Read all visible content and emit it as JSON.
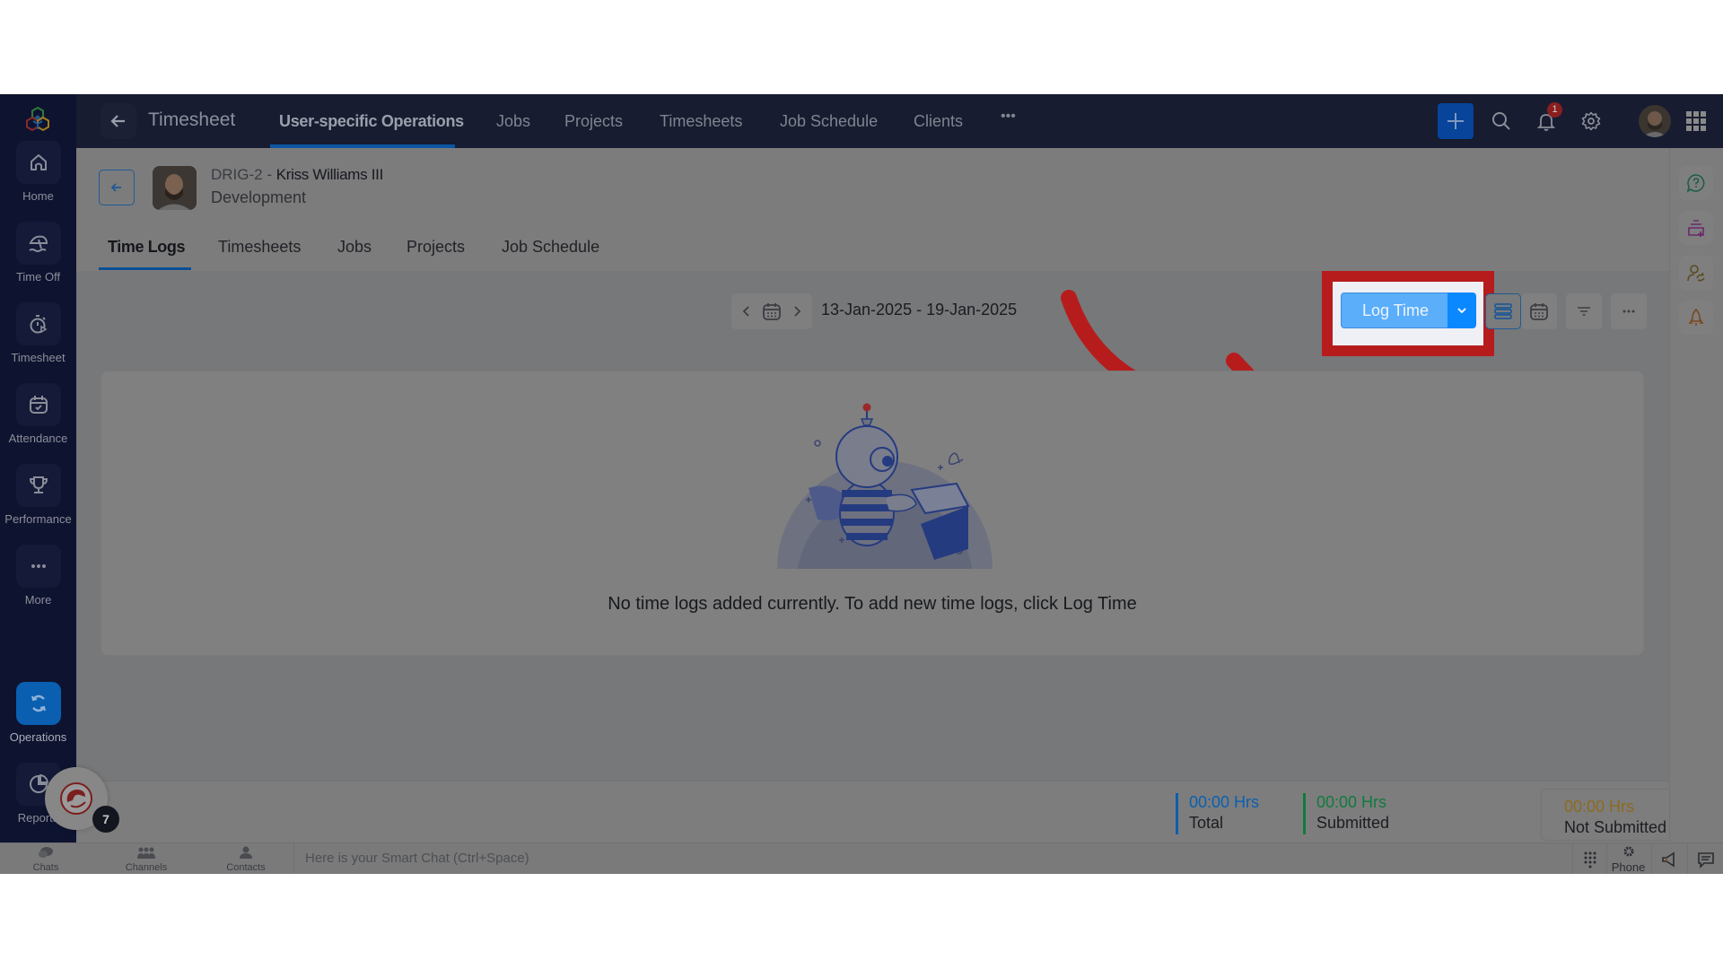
{
  "sidebar": {
    "items": [
      {
        "label": "Home",
        "icon": "home-icon"
      },
      {
        "label": "Time Off",
        "icon": "umbrella-icon"
      },
      {
        "label": "Timesheet",
        "icon": "stopwatch-icon"
      },
      {
        "label": "Attendance",
        "icon": "calendar-check-icon"
      },
      {
        "label": "Performance",
        "icon": "trophy-icon"
      },
      {
        "label": "More",
        "icon": "more-icon"
      },
      {
        "label": "Operations",
        "icon": "sync-icon",
        "active": true
      },
      {
        "label": "Reports",
        "icon": "pie-chart-icon"
      }
    ]
  },
  "topbar": {
    "title": "Timesheet",
    "tabs": [
      {
        "label": "User-specific Operations",
        "active": true
      },
      {
        "label": "Jobs"
      },
      {
        "label": "Projects"
      },
      {
        "label": "Timesheets"
      },
      {
        "label": "Job Schedule"
      },
      {
        "label": "Clients"
      },
      {
        "label": "•••"
      }
    ],
    "notification_count": "1"
  },
  "employee": {
    "code": "DRIG-2 - ",
    "name": "Kriss Williams III",
    "department": "Development"
  },
  "sub_tabs": [
    {
      "label": "Time Logs",
      "active": true
    },
    {
      "label": "Timesheets"
    },
    {
      "label": "Jobs"
    },
    {
      "label": "Projects"
    },
    {
      "label": "Job Schedule"
    }
  ],
  "toolbar": {
    "date_range": "13-Jan-2025 - 19-Jan-2025",
    "log_time_label": "Log Time"
  },
  "empty_state": {
    "message": "No time logs added currently. To add new time logs, click Log Time"
  },
  "summary": {
    "total": {
      "value": "00:00 Hrs",
      "label": "Total",
      "color": "#0a5fb0"
    },
    "submitted": {
      "value": "00:00 Hrs",
      "label": "Submitted",
      "color": "#117a3d"
    },
    "not_submitted": {
      "value": "00:00 Hrs",
      "label": "Not Submitted",
      "color": "#8c6a1e"
    }
  },
  "bot": {
    "badge": "7"
  },
  "chatbar": {
    "tabs": [
      {
        "label": "Chats"
      },
      {
        "label": "Channels"
      },
      {
        "label": "Contacts"
      }
    ],
    "placeholder": "Here is your Smart Chat (Ctrl+Space)",
    "phone_label": "Phone"
  },
  "annotation": {
    "color": "#b71c1c"
  }
}
